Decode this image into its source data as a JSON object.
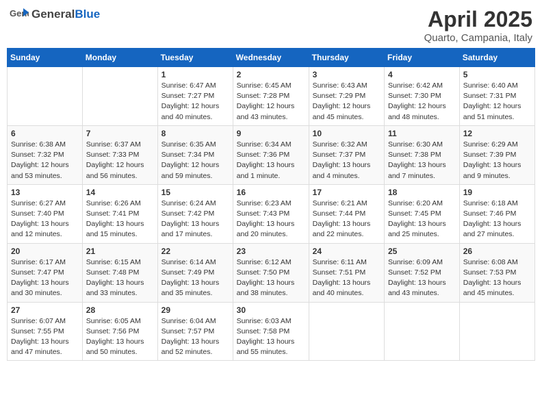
{
  "header": {
    "logo_general": "General",
    "logo_blue": "Blue",
    "month_title": "April 2025",
    "location": "Quarto, Campania, Italy"
  },
  "days_of_week": [
    "Sunday",
    "Monday",
    "Tuesday",
    "Wednesday",
    "Thursday",
    "Friday",
    "Saturday"
  ],
  "weeks": [
    [
      {
        "day": "",
        "info": ""
      },
      {
        "day": "",
        "info": ""
      },
      {
        "day": "1",
        "info": "Sunrise: 6:47 AM\nSunset: 7:27 PM\nDaylight: 12 hours and 40 minutes."
      },
      {
        "day": "2",
        "info": "Sunrise: 6:45 AM\nSunset: 7:28 PM\nDaylight: 12 hours and 43 minutes."
      },
      {
        "day": "3",
        "info": "Sunrise: 6:43 AM\nSunset: 7:29 PM\nDaylight: 12 hours and 45 minutes."
      },
      {
        "day": "4",
        "info": "Sunrise: 6:42 AM\nSunset: 7:30 PM\nDaylight: 12 hours and 48 minutes."
      },
      {
        "day": "5",
        "info": "Sunrise: 6:40 AM\nSunset: 7:31 PM\nDaylight: 12 hours and 51 minutes."
      }
    ],
    [
      {
        "day": "6",
        "info": "Sunrise: 6:38 AM\nSunset: 7:32 PM\nDaylight: 12 hours and 53 minutes."
      },
      {
        "day": "7",
        "info": "Sunrise: 6:37 AM\nSunset: 7:33 PM\nDaylight: 12 hours and 56 minutes."
      },
      {
        "day": "8",
        "info": "Sunrise: 6:35 AM\nSunset: 7:34 PM\nDaylight: 12 hours and 59 minutes."
      },
      {
        "day": "9",
        "info": "Sunrise: 6:34 AM\nSunset: 7:36 PM\nDaylight: 13 hours and 1 minute."
      },
      {
        "day": "10",
        "info": "Sunrise: 6:32 AM\nSunset: 7:37 PM\nDaylight: 13 hours and 4 minutes."
      },
      {
        "day": "11",
        "info": "Sunrise: 6:30 AM\nSunset: 7:38 PM\nDaylight: 13 hours and 7 minutes."
      },
      {
        "day": "12",
        "info": "Sunrise: 6:29 AM\nSunset: 7:39 PM\nDaylight: 13 hours and 9 minutes."
      }
    ],
    [
      {
        "day": "13",
        "info": "Sunrise: 6:27 AM\nSunset: 7:40 PM\nDaylight: 13 hours and 12 minutes."
      },
      {
        "day": "14",
        "info": "Sunrise: 6:26 AM\nSunset: 7:41 PM\nDaylight: 13 hours and 15 minutes."
      },
      {
        "day": "15",
        "info": "Sunrise: 6:24 AM\nSunset: 7:42 PM\nDaylight: 13 hours and 17 minutes."
      },
      {
        "day": "16",
        "info": "Sunrise: 6:23 AM\nSunset: 7:43 PM\nDaylight: 13 hours and 20 minutes."
      },
      {
        "day": "17",
        "info": "Sunrise: 6:21 AM\nSunset: 7:44 PM\nDaylight: 13 hours and 22 minutes."
      },
      {
        "day": "18",
        "info": "Sunrise: 6:20 AM\nSunset: 7:45 PM\nDaylight: 13 hours and 25 minutes."
      },
      {
        "day": "19",
        "info": "Sunrise: 6:18 AM\nSunset: 7:46 PM\nDaylight: 13 hours and 27 minutes."
      }
    ],
    [
      {
        "day": "20",
        "info": "Sunrise: 6:17 AM\nSunset: 7:47 PM\nDaylight: 13 hours and 30 minutes."
      },
      {
        "day": "21",
        "info": "Sunrise: 6:15 AM\nSunset: 7:48 PM\nDaylight: 13 hours and 33 minutes."
      },
      {
        "day": "22",
        "info": "Sunrise: 6:14 AM\nSunset: 7:49 PM\nDaylight: 13 hours and 35 minutes."
      },
      {
        "day": "23",
        "info": "Sunrise: 6:12 AM\nSunset: 7:50 PM\nDaylight: 13 hours and 38 minutes."
      },
      {
        "day": "24",
        "info": "Sunrise: 6:11 AM\nSunset: 7:51 PM\nDaylight: 13 hours and 40 minutes."
      },
      {
        "day": "25",
        "info": "Sunrise: 6:09 AM\nSunset: 7:52 PM\nDaylight: 13 hours and 43 minutes."
      },
      {
        "day": "26",
        "info": "Sunrise: 6:08 AM\nSunset: 7:53 PM\nDaylight: 13 hours and 45 minutes."
      }
    ],
    [
      {
        "day": "27",
        "info": "Sunrise: 6:07 AM\nSunset: 7:55 PM\nDaylight: 13 hours and 47 minutes."
      },
      {
        "day": "28",
        "info": "Sunrise: 6:05 AM\nSunset: 7:56 PM\nDaylight: 13 hours and 50 minutes."
      },
      {
        "day": "29",
        "info": "Sunrise: 6:04 AM\nSunset: 7:57 PM\nDaylight: 13 hours and 52 minutes."
      },
      {
        "day": "30",
        "info": "Sunrise: 6:03 AM\nSunset: 7:58 PM\nDaylight: 13 hours and 55 minutes."
      },
      {
        "day": "",
        "info": ""
      },
      {
        "day": "",
        "info": ""
      },
      {
        "day": "",
        "info": ""
      }
    ]
  ]
}
